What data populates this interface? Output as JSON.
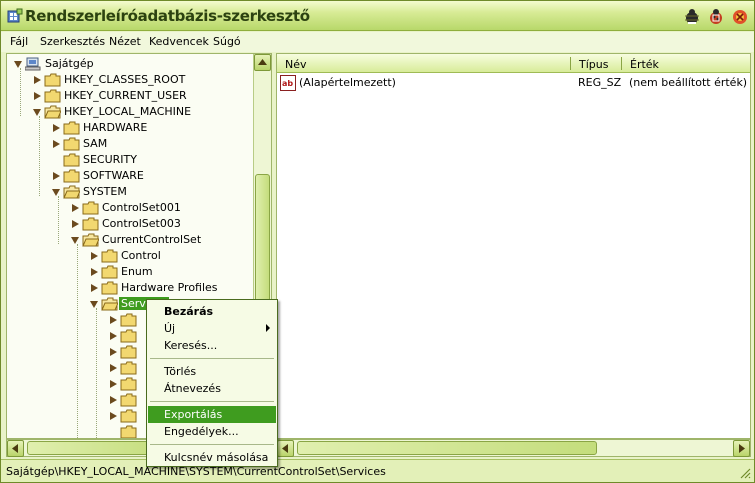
{
  "window": {
    "title": "Rendszerleíróadatbázis-szerkesztő"
  },
  "menu": [
    "Fájl",
    "Szerkesztés",
    "Nézet",
    "Kedvencek",
    "Súgó"
  ],
  "tree": {
    "root": "Sajátgép",
    "hives": [
      "HKEY_CLASSES_ROOT",
      "HKEY_CURRENT_USER",
      "HKEY_LOCAL_MACHINE"
    ],
    "hklm": [
      "HARDWARE",
      "SAM",
      "SECURITY",
      "SOFTWARE",
      "SYSTEM"
    ],
    "system": [
      "ControlSet001",
      "ControlSet003",
      "CurrentControlSet"
    ],
    "ccs": [
      "Control",
      "Enum",
      "Hardware Profiles",
      "Services"
    ]
  },
  "list": {
    "headers": {
      "name": "Név",
      "type": "Típus",
      "data": "Érték"
    },
    "rows": [
      {
        "name": "(Alapértelmezett)",
        "type": "REG_SZ",
        "data": "(nem beállított érték)",
        "icon": "string-value-icon"
      }
    ]
  },
  "context_menu": {
    "collapse": "Bezárás",
    "new": "Új",
    "find": "Keresés...",
    "delete": "Törlés",
    "rename": "Átnevezés",
    "export": "Exportálás",
    "permissions": "Engedélyek...",
    "copy_key_name": "Kulcsnév másolása"
  },
  "status": {
    "path": "Sajátgép\\HKEY_LOCAL_MACHINE\\SYSTEM\\CurrentControlSet\\Services"
  },
  "colors": {
    "accent": "#3f9c1f",
    "title_gradient_end": "#b8d86a",
    "folder": "#f2d870"
  }
}
